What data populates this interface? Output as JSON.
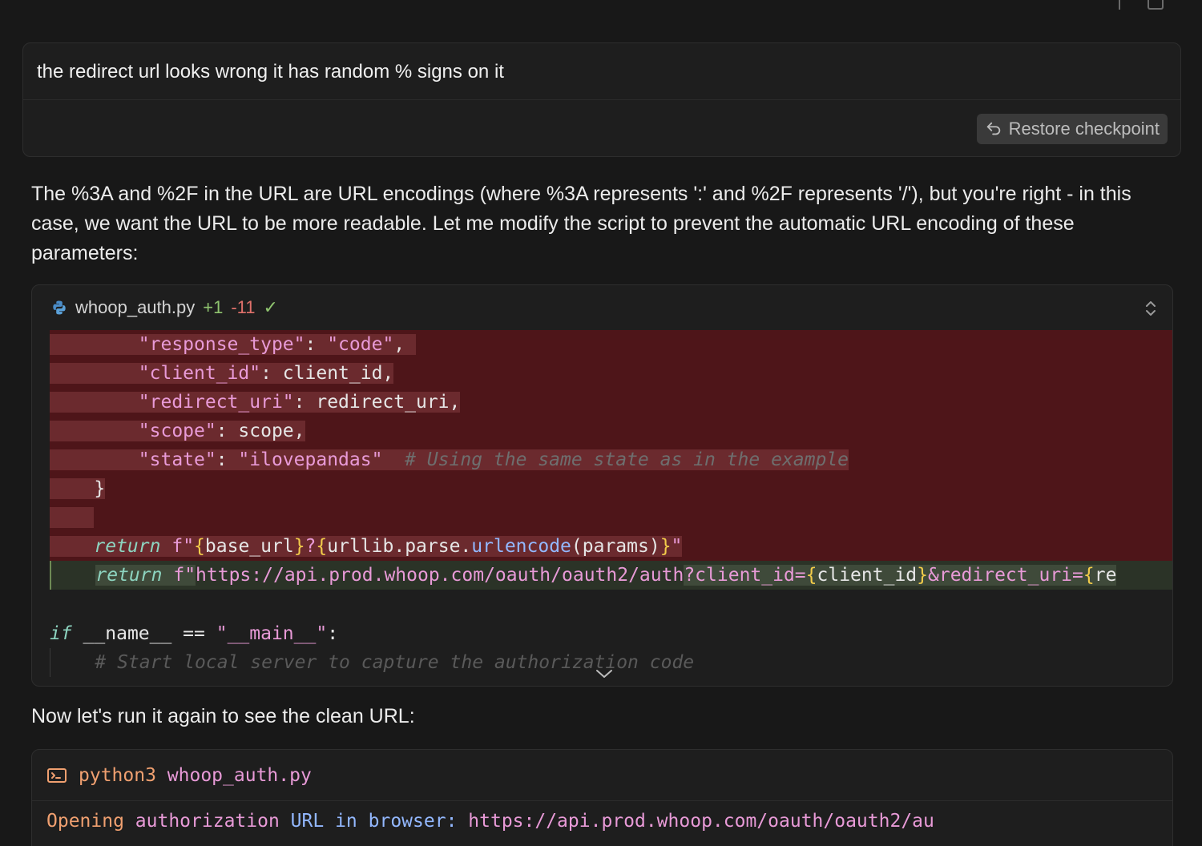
{
  "user_message": {
    "text": "the redirect url looks wrong it has random % signs on it",
    "restore_label": "Restore checkpoint"
  },
  "assistant": {
    "paragraph1": "The %3A and %2F in the URL are URL encodings (where %3A represents ':' and %2F represents '/'), but you're right - in this case, we want the URL to be more readable. Let me modify the script to prevent the automatic URL encoding of these parameters:",
    "paragraph2": "Now let's run it again to see the clean URL:"
  },
  "code_block": {
    "filename": "whoop_auth.py",
    "additions": "+1",
    "deletions": "-11",
    "check": "✓",
    "lines": {
      "l1_key": "\"response_type\"",
      "l1_sep": ": ",
      "l1_val": "\"code\"",
      "l1_end": ",",
      "l2_key": "\"client_id\"",
      "l2_rest": ": client_id,",
      "l3_key": "\"redirect_uri\"",
      "l3_rest": ": redirect_uri,",
      "l4_key": "\"scope\"",
      "l4_rest": ": scope,",
      "l5_key": "\"state\"",
      "l5_sep": ": ",
      "l5_val": "\"ilovepandas\"",
      "l5_cmt": "# Using the same state as in the example",
      "l6": "}",
      "l8_kw": "return",
      "l8_f": "f\"",
      "l8_b1": "{",
      "l8_v1": "base_url",
      "l8_b2": "}",
      "l8_q": "?",
      "l8_b3": "{",
      "l8_v2": "urllib.parse.",
      "l8_fn": "urlencode",
      "l8_v3": "(params)",
      "l8_b4": "}",
      "l8_endq": "\"",
      "l9_kw": "return",
      "l9_f": "f\"",
      "l9_url": "https://api.prod.whoop.com/oauth/oauth2/auth",
      "l9_q": "?client_id=",
      "l9_b1": "{",
      "l9_v1": "client_id",
      "l9_b2": "}",
      "l9_q2": "&redirect_uri=",
      "l9_b3": "{",
      "l9_v2": "re",
      "l10_kw": "if",
      "l10_rest": " __name__ == ",
      "l10_str": "\"__main__\"",
      "l10_end": ":",
      "l11_cmt": "# Start local server to capture the authorization code"
    }
  },
  "terminal": {
    "cmd": "python3",
    "arg": "whoop_auth.py",
    "out_word1": "Opening",
    "out_word2": "authorization",
    "out_word3": "URL",
    "out_word4": "in",
    "out_word5": "browser:",
    "out_url": "https://api.prod.whoop.com/oauth/oauth2/au"
  },
  "colors": {
    "background": "#181818",
    "deleted_line": "#4e1519",
    "added_line": "#2b3327",
    "string": "#e89ad7",
    "keyword": "#8dd4c0",
    "function": "#93b8ff",
    "brace": "#f2cc4a"
  },
  "icons": {
    "restore": "undo-arrow-icon",
    "file": "python-icon",
    "expand": "chevron-up-down-icon",
    "collapse": "chevron-down-icon",
    "terminal": "terminal-icon"
  }
}
